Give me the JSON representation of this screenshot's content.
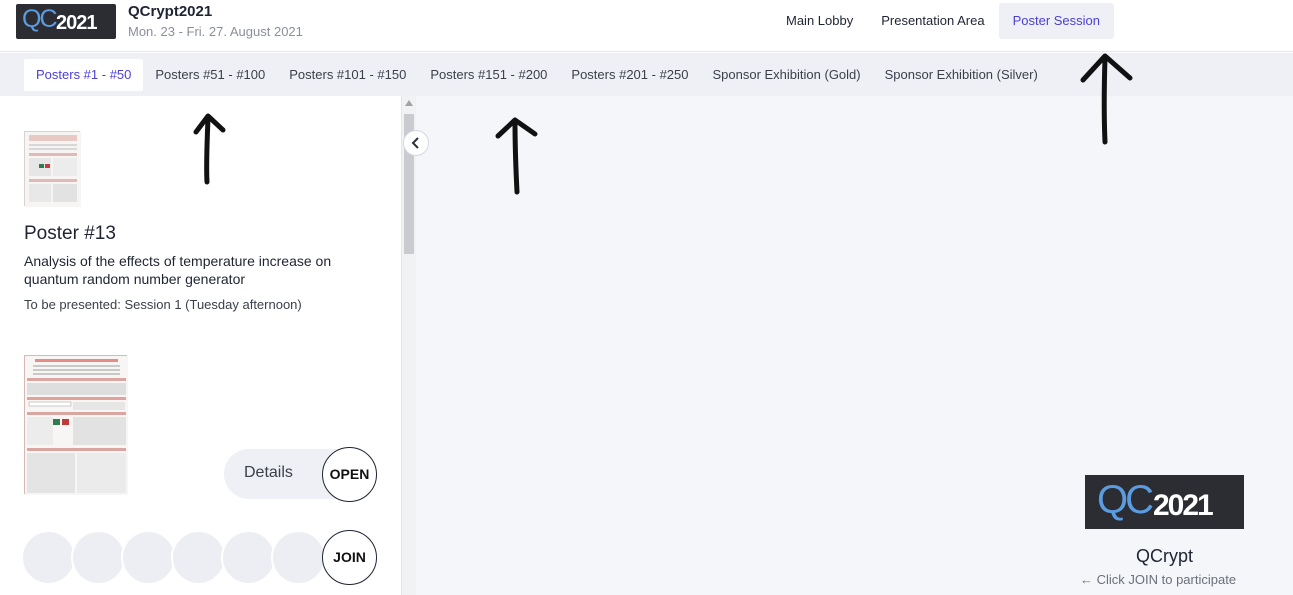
{
  "header": {
    "logo": {
      "prefix": "QC",
      "year": "2021"
    },
    "title": "QCrypt2021",
    "dates": "Mon. 23 - Fri. 27. August 2021",
    "nav": [
      "Main Lobby",
      "Presentation Area",
      "Poster Session"
    ],
    "active_nav": "Poster Session"
  },
  "tabs": {
    "items": [
      "Posters #1 - #50",
      "Posters #51 - #100",
      "Posters #101 - #150",
      "Posters #151 - #200",
      "Posters #201 - #250",
      "Sponsor Exhibition (Gold)",
      "Sponsor Exhibition (Silver)"
    ],
    "active": "Posters #1 - #50"
  },
  "poster": {
    "title": "Poster #13",
    "description": "Analysis of the effects of temperature increase on quantum random number generator",
    "session": "To be presented: Session 1 (Tuesday afternoon)",
    "details_label": "Details",
    "open_label": "OPEN",
    "join_label": "JOIN"
  },
  "collapse_icon": "chevron-left",
  "brand": {
    "logo": {
      "prefix": "QC",
      "year": "2021"
    },
    "name": "QCrypt",
    "hint": "Click JOIN to participate",
    "hint_icon": "arrow-left"
  },
  "colors": {
    "accent": "#4b3fd6",
    "tab_bar": "#eef0f5",
    "main_bg": "#f4f6f9",
    "logo_bg": "#2b2d33",
    "logo_blue": "#5b9be0"
  }
}
